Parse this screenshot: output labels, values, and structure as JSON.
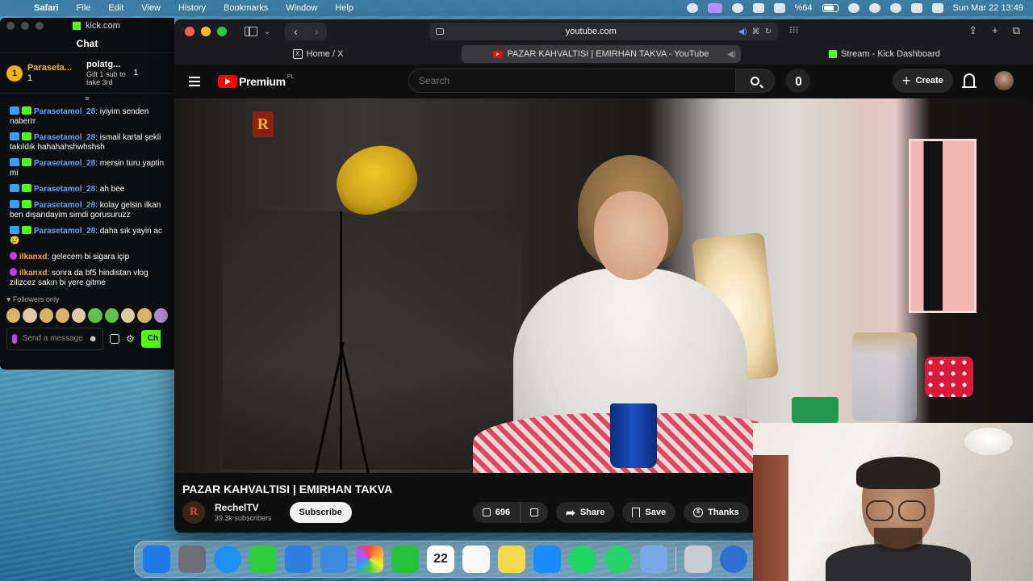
{
  "menubar": {
    "app": "Safari",
    "items": [
      "File",
      "Edit",
      "View",
      "History",
      "Bookmarks",
      "Window",
      "Help"
    ],
    "battery": "%64",
    "datetime": "Sun Mar 22  13:49"
  },
  "kick": {
    "window_title": "kick.com",
    "chat_title": "Chat",
    "leader1": {
      "rank": "1",
      "name": "Parasetа...",
      "count": "1"
    },
    "leader2": {
      "name": "polatg...",
      "count": "1",
      "gift_line1": "Gift 1 sub to",
      "gift_line2": "take 3rd"
    },
    "messages": [
      {
        "user": "Parasetamol_28",
        "text": ": iyiyim senden naberrr"
      },
      {
        "user": "Parasetamol_28",
        "text": ": ismail kartal şekli takıldık hahahahshwhshsh"
      },
      {
        "user": "Parasetamol_28",
        "text": ": mersin turu yaptin mi"
      },
      {
        "user": "Parasetamol_28",
        "text": ": ah bee"
      },
      {
        "user": "Parasetamol_28",
        "text": ": kolay gelsin ilkan ben dışarıdayim simdi gorusuruzz"
      },
      {
        "user": "Parasetamol_28",
        "text": ": daha sık yayin ac 😢"
      },
      {
        "user": "ilkanxd",
        "text": ": gelecem bi sigara içip"
      },
      {
        "user": "ilkanxd",
        "text": ": sonra da bf5 hindistan vlog zilizcez sakın bi yere gitme"
      }
    ],
    "followers_only": "Followers only",
    "input_placeholder": "Send a message",
    "chat_button": "Ch"
  },
  "safari": {
    "url": "youtube.com",
    "tabs": [
      {
        "label": "Home / X"
      },
      {
        "label": "PAZAR KAHVALTISI | EMIRHAN TAKVA - YouTube"
      },
      {
        "label": "Stream - Kick Dashboard"
      }
    ]
  },
  "youtube": {
    "logo": "Premium",
    "logo_region": "PL",
    "search_placeholder": "Search",
    "create_label": "Create",
    "video_logo_letter": "R",
    "video_title": "PAZAR KAHVALTISI | EMIRHAN TAKVA",
    "channel": {
      "name": "RechelTV",
      "subs": "39.3k subscribers",
      "avatar_letter": "R"
    },
    "subscribe_label": "Subscribe",
    "likes": "696",
    "share_label": "Share",
    "save_label": "Save",
    "thanks_label": "Thanks"
  },
  "dock": {
    "calendar_day": "22",
    "apps": [
      "Finder",
      "Launchpad",
      "Safari",
      "Messages",
      "Mail",
      "Xcode",
      "Photos",
      "FaceTime",
      "Calendar",
      "Reminders",
      "Notes",
      "App Store",
      "Spotify",
      "WhatsApp",
      "Preview",
      "Trash",
      "Overflow"
    ]
  }
}
